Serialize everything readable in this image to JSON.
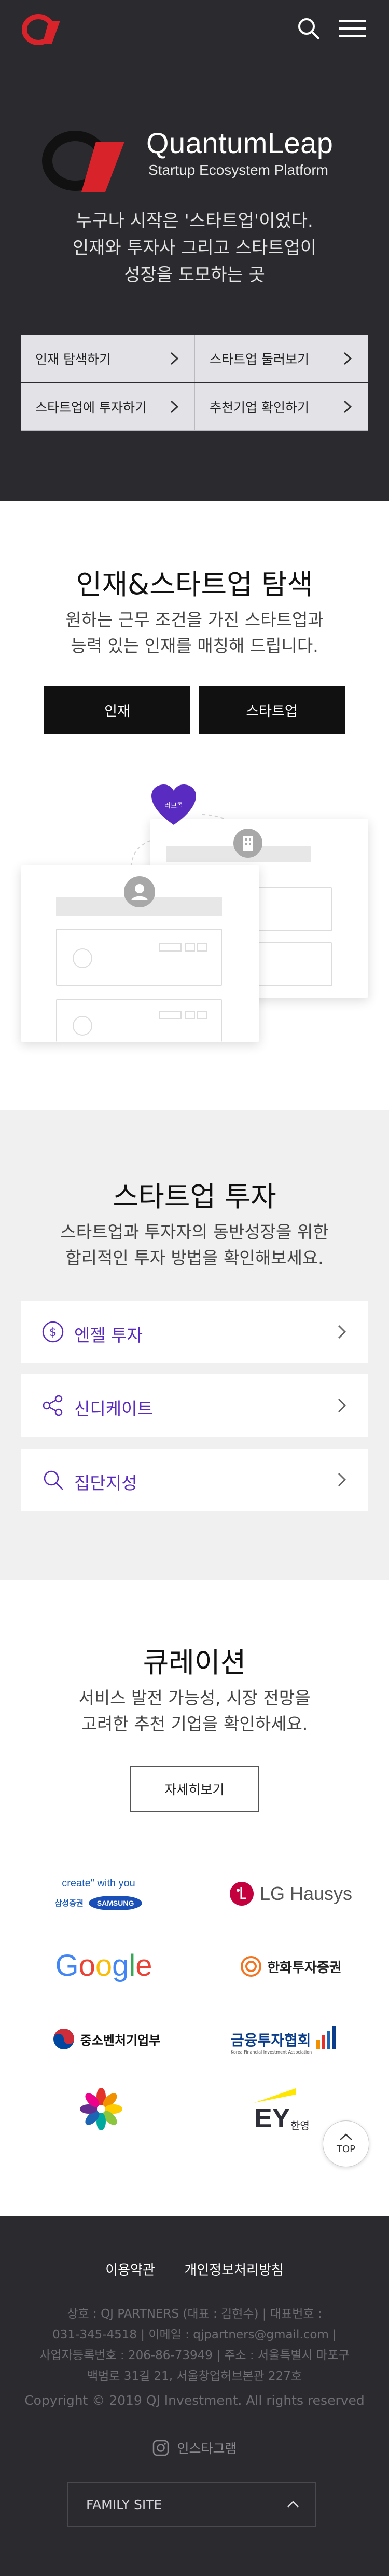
{
  "header": {
    "logo_icon": "quantumleap-q-logo",
    "search_icon": "search-icon",
    "menu_icon": "hamburger-menu-icon"
  },
  "hero": {
    "brand_name": "QuantumLeap",
    "brand_subtitle": "Startup Ecosystem Platform",
    "lines": [
      "누구나 시작은 '스타트업'이었다.",
      "인재와 투자사 그리고 스타트업이",
      "성장을 도모하는 곳"
    ],
    "buttons": [
      "인재 탐색하기",
      "스타트업 둘러보기",
      "스타트업에 투자하기",
      "추천기업 확인하기"
    ]
  },
  "explore": {
    "title": "인재&스타트업 탐색",
    "desc": [
      "원하는 근무 조건을 가진 스타트업과",
      "능력 있는 인재를 매칭해 드립니다."
    ],
    "buttons": [
      "인재",
      "스타트업"
    ],
    "heart_label": "러브콜"
  },
  "invest": {
    "title": "스타트업 투자",
    "desc": [
      "스타트업과 투자자의 동반성장을 위한",
      "합리적인 투자 방법을 확인해보세요."
    ],
    "items": [
      {
        "label": "엔젤 투자",
        "icon": "dollar-coin-icon"
      },
      {
        "label": "신디케이트",
        "icon": "share-nodes-icon"
      },
      {
        "label": "집단지성",
        "icon": "search-icon"
      }
    ]
  },
  "curation": {
    "title": "큐레이션",
    "desc": [
      "서비스 발전 가능성, 시장 전망을",
      "고려한 추천 기업을 확인하세요."
    ],
    "more_button": "자세히보기",
    "partners": {
      "samsung_tagline": "create\" with you",
      "samsung_a": "삼성증권",
      "samsung_b": "SAMSUNG",
      "lg": "LG Hausys",
      "google": [
        "G",
        "o",
        "o",
        "g",
        "l",
        "e"
      ],
      "hanwha": "한화투자증권",
      "mss": "중소벤처기업부",
      "kofia": "금융투자협회",
      "kofia_sub": "Korea Financial Investment Association",
      "ey": "EY",
      "ey_sub": "한영"
    },
    "colors": {
      "google": [
        "#4285f4",
        "#ea4335",
        "#fbbc05",
        "#4285f4",
        "#34a853",
        "#ea4335"
      ]
    }
  },
  "top_button": "TOP",
  "footer": {
    "links": [
      "이용약관",
      "개인정보처리방침"
    ],
    "info": [
      "상호 : QJ PARTNERS (대표 : 김현수)  |  대표번호 :",
      "031-345-4518  |  이메일 : qjpartners@gmail.com  |",
      "사업자등록번호 : 206-86-73949  |  주소 : 서울특별시 마포구",
      "백범로 31길 21, 서울창업허브본관 227호"
    ],
    "copyright": "Copyright © 2019 QJ Investment. All rights reserved",
    "instagram": "인스타그램",
    "family_site": "FAMILY SITE"
  },
  "accent_colors": {
    "brand_red": "#d8232a",
    "purple": "#5a2bc0",
    "dark": "#2b2a2e"
  }
}
